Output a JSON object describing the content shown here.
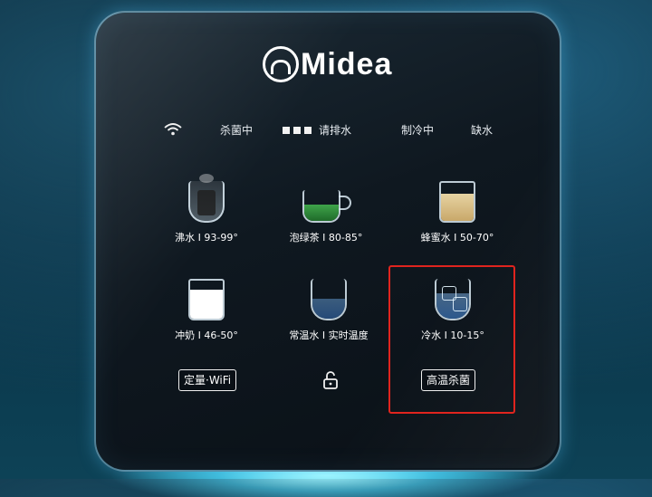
{
  "brand": {
    "name": "Midea"
  },
  "status_bar": {
    "wifi_icon": "wifi-icon",
    "sterilizing": "杀菌中",
    "drain_prompt": "请排水",
    "cooling": "制冷中",
    "water_shortage": "缺水"
  },
  "drinks": [
    {
      "icon": "boiling-water-icon",
      "label": "沸水 I 93-99°"
    },
    {
      "icon": "green-tea-icon",
      "label": "泡绿茶 I 80-85°"
    },
    {
      "icon": "honey-water-icon",
      "label": "蜂蜜水 I 50-70°"
    },
    {
      "icon": "milk-icon",
      "label": "冲奶 I 46-50°"
    },
    {
      "icon": "room-temp-water-icon",
      "label": "常温水 I 实时温度"
    },
    {
      "icon": "cold-water-icon",
      "label": "冷水 I 10-15°"
    }
  ],
  "controls": {
    "quantity_wifi": "定量·WiFi",
    "lock_icon": "lock-icon",
    "high_temp_sterilize": "高温杀菌"
  },
  "colors": {
    "panel": "#0f1820",
    "highlight_box": "#e0241e",
    "tea": "#2e8b3a",
    "honey": "#d8c08a",
    "milk": "#ffffff",
    "water": "#3a6f9e"
  }
}
